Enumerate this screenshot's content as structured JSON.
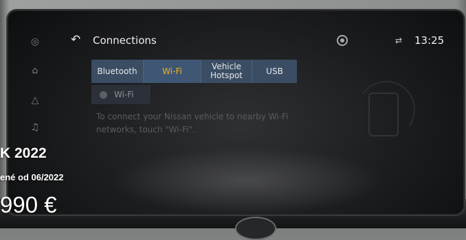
{
  "header": {
    "back_icon": "back-arrow-icon",
    "title": "Connections",
    "settings_icon": "gear-icon",
    "status_icon": "signal-icon",
    "time": "13:25"
  },
  "rail": {
    "icons": [
      "navigation-icon",
      "home-icon",
      "warning-icon",
      "music-icon"
    ]
  },
  "tabs": [
    {
      "label": "Bluetooth",
      "active": false
    },
    {
      "label": "Wi-Fi",
      "active": true
    },
    {
      "label_line1": "Vehicle",
      "label_line2": "Hotspot",
      "active": false
    },
    {
      "label": "USB",
      "active": false
    }
  ],
  "wifi_toggle": {
    "label": "Wi-Fi",
    "state": "off"
  },
  "help_text": "To connect your Nissan vehicle to nearby Wi-Fi networks, touch \"Wi-Fi\".",
  "listing": {
    "title": "K 2022",
    "date": "ené od 06/2022",
    "price": "990 €"
  },
  "colors": {
    "tab_bg": "#3a4d63",
    "active_tab_text": "#f2b21b",
    "screen_bg": "#1c1d1f"
  }
}
